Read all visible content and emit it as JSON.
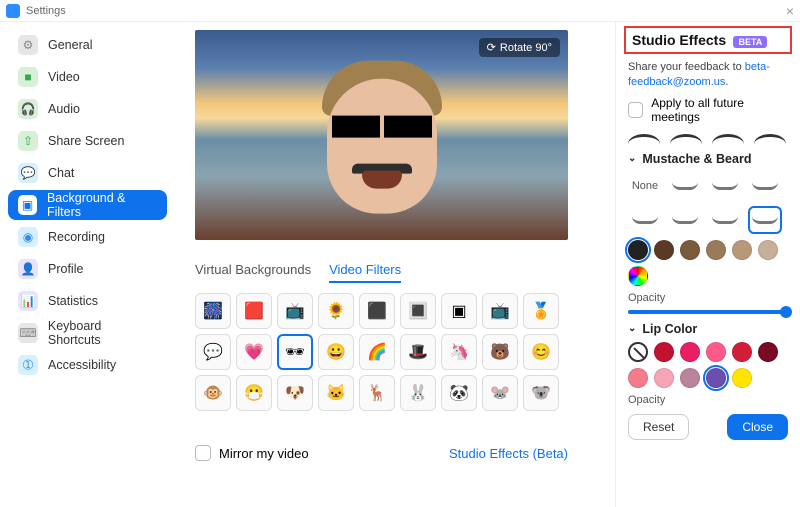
{
  "window": {
    "title": "Settings",
    "close_glyph": "×"
  },
  "sidebar": {
    "items": [
      {
        "label": "General",
        "icon": "gear-icon",
        "bg": "#e6e6e6",
        "fg": "#888",
        "glyph": "⚙"
      },
      {
        "label": "Video",
        "icon": "video-icon",
        "bg": "#d7f0d7",
        "fg": "#2fa84f",
        "glyph": "■"
      },
      {
        "label": "Audio",
        "icon": "audio-icon",
        "bg": "#d7f0d7",
        "fg": "#2fa84f",
        "glyph": "🎧"
      },
      {
        "label": "Share Screen",
        "icon": "share-screen-icon",
        "bg": "#d7f0d7",
        "fg": "#2fa84f",
        "glyph": "⇧"
      },
      {
        "label": "Chat",
        "icon": "chat-icon",
        "bg": "#d7f0ff",
        "fg": "#2d8cff",
        "glyph": "💬"
      },
      {
        "label": "Background & Filters",
        "icon": "background-filters-icon",
        "bg": "#0e72ed",
        "fg": "#fff",
        "glyph": "▣",
        "active": true
      },
      {
        "label": "Recording",
        "icon": "recording-icon",
        "bg": "#d7f0ff",
        "fg": "#2d8cff",
        "glyph": "◉"
      },
      {
        "label": "Profile",
        "icon": "profile-icon",
        "bg": "#e9e2ff",
        "fg": "#7b61ff",
        "glyph": "👤"
      },
      {
        "label": "Statistics",
        "icon": "statistics-icon",
        "bg": "#e9e2ff",
        "fg": "#7b61ff",
        "glyph": "📊"
      },
      {
        "label": "Keyboard Shortcuts",
        "icon": "keyboard-shortcuts-icon",
        "bg": "#e6e6e6",
        "fg": "#888",
        "glyph": "⌨"
      },
      {
        "label": "Accessibility",
        "icon": "accessibility-icon",
        "bg": "#d7f0ff",
        "fg": "#2d8cff",
        "glyph": "➀"
      }
    ]
  },
  "preview": {
    "rotate_label": "Rotate 90°"
  },
  "tabs": {
    "virtual_backgrounds": "Virtual Backgrounds",
    "video_filters": "Video Filters",
    "active": "video_filters"
  },
  "filters": {
    "selected_index": 11,
    "items": [
      "🎆",
      "🟥",
      "📺",
      "🌻",
      "⬛",
      "🔳",
      "▣",
      "📺",
      "🏅",
      "💬",
      "💗",
      "🕶",
      "😀",
      "🌈",
      "🎩",
      "🦄",
      "🐻",
      "😊",
      "🐵",
      "😷",
      "🐶",
      "🐱",
      "🦌",
      "🐰",
      "🐼",
      "🐭",
      "🐨"
    ]
  },
  "mirror": {
    "label": "Mirror my video",
    "checked": false
  },
  "studio_link": "Studio Effects (Beta)",
  "panel": {
    "title": "Studio Effects",
    "badge": "BETA",
    "feedback_prefix": "Share your feedback to  ",
    "feedback_link": "beta-feedback@zoom.us",
    "feedback_suffix": ".",
    "apply_label": "Apply to all future meetings",
    "apply_checked": false,
    "mustache_section": "Mustache & Beard",
    "mustache_none": "None",
    "mustache_selected_index": 7,
    "mustache_colors": [
      "#222222",
      "#5a3a24",
      "#7a5a3a",
      "#9a7a5a",
      "#b89878",
      "#c8b098"
    ],
    "mustache_color_selected": 0,
    "opacity_label": "Opacity",
    "lip_section": "Lip Color",
    "lip_colors": [
      "#c1122f",
      "#e91e63",
      "#ff5a8a",
      "#d11f3a",
      "#7a0b23",
      "#f47c8a",
      "#f6a5b4",
      "#b8839b",
      "#6a4fb0",
      "#ffe400"
    ],
    "lip_selected_index": 8,
    "reset": "Reset",
    "close": "Close"
  }
}
